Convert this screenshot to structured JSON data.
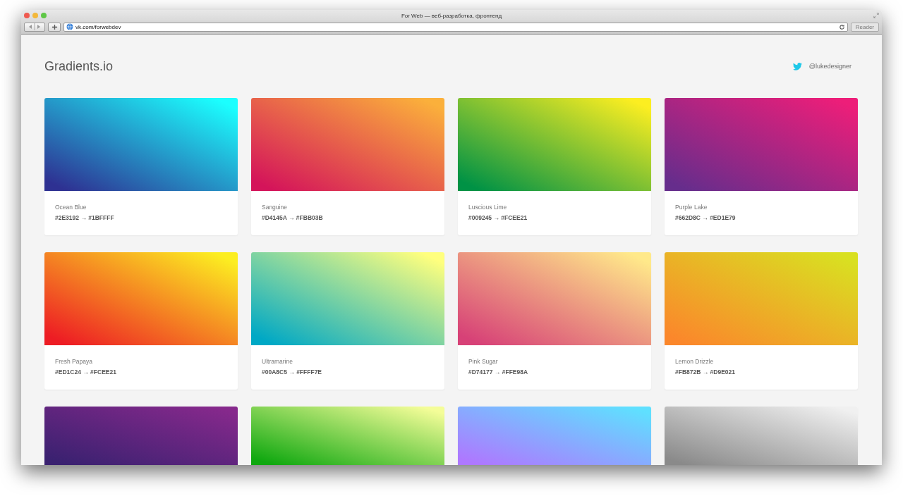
{
  "window": {
    "title": "For Web — веб-разработка, фронтенд",
    "url": "vk.com/forwebdev",
    "reader_button": "Reader"
  },
  "header": {
    "logo": "Gradients.io",
    "twitter_handle": "@lukedesigner"
  },
  "gradients": [
    {
      "name": "Ocean Blue",
      "codes": "#2E3192 → #1BFFFF",
      "stops": [
        {
          "color": "#2e3192"
        },
        {
          "color": "#1bffff"
        }
      ]
    },
    {
      "name": "Sanguine",
      "codes": "#D4145A → #FBB03B",
      "stops": [
        {
          "color": "#d4145a"
        },
        {
          "color": "#fbb03b"
        }
      ]
    },
    {
      "name": "Luscious Lime",
      "codes": "#009245 → #FCEE21",
      "stops": [
        {
          "color": "#009245"
        },
        {
          "color": "#fcee21"
        }
      ]
    },
    {
      "name": "Purple Lake",
      "codes": "#662D8C → #ED1E79",
      "stops": [
        {
          "color": "#662d8c"
        },
        {
          "color": "#ed1e79"
        }
      ]
    },
    {
      "name": "Fresh Papaya",
      "codes": "#ED1C24 → #FCEE21",
      "stops": [
        {
          "color": "#ed1c24"
        },
        {
          "color": "#fcee21"
        }
      ]
    },
    {
      "name": "Ultramarine",
      "codes": "#00A8C5 → #FFFF7E",
      "stops": [
        {
          "color": "#00a8c5"
        },
        {
          "color": "#ffff7e"
        }
      ]
    },
    {
      "name": "Pink Sugar",
      "codes": "#D74177 → #FFE98A",
      "stops": [
        {
          "color": "#d74177"
        },
        {
          "color": "#ffe98a"
        }
      ]
    },
    {
      "name": "Lemon Drizzle",
      "codes": "#FB872B → #D9E021",
      "stops": [
        {
          "color": "#fb872b"
        },
        {
          "color": "#d9e021"
        }
      ]
    },
    {
      "stops": [
        {
          "color": "#3a2170"
        },
        {
          "color": "#86298c"
        }
      ]
    },
    {
      "stops": [
        {
          "color": "#10a810"
        },
        {
          "color": "#f4fd98"
        }
      ]
    },
    {
      "stops": [
        {
          "color": "#ae78ff"
        },
        {
          "color": "#5fe0ff"
        }
      ]
    },
    {
      "stops": [
        {
          "color": "#8a8a8a"
        },
        {
          "color": "#f0f0f0"
        }
      ]
    }
  ]
}
